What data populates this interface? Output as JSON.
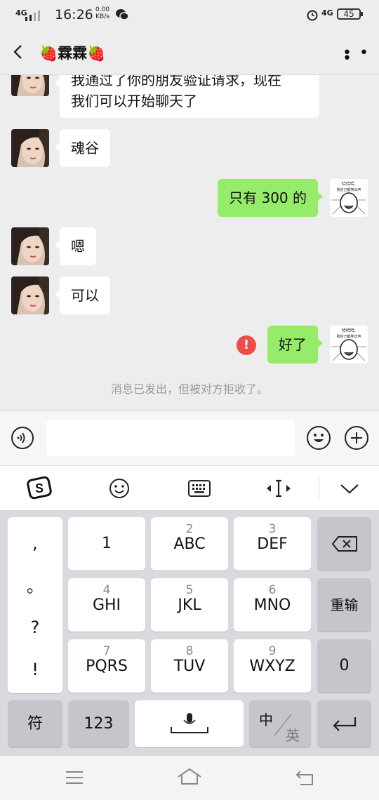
{
  "status_bar": {
    "network": "4G",
    "time": "16:26",
    "speed_value": "0.00",
    "speed_unit": "KB/s",
    "network2": "4G",
    "battery": "45"
  },
  "header": {
    "contact_name": "🍓霖霖🍓"
  },
  "messages": [
    {
      "side": "left",
      "text_line1": "我通过了你的朋友验证请求，现在",
      "text_line2": "我们可以开始聊天了"
    },
    {
      "side": "left",
      "text": "魂谷"
    },
    {
      "side": "right",
      "text": "只有 300 的"
    },
    {
      "side": "left",
      "text": "嗯"
    },
    {
      "side": "left",
      "text": "可以"
    },
    {
      "side": "right",
      "text": "好了",
      "error": "!"
    }
  ],
  "sticker_text": {
    "line1": "哈哈哈,",
    "line2": "我自己都笑出声"
  },
  "system_note": "消息已发出，但被对方拒收了。",
  "input": {
    "placeholder": ""
  },
  "keyboard": {
    "punctuation": [
      ",",
      "。",
      "?",
      "!"
    ],
    "keys": [
      {
        "num": "",
        "letters": "1"
      },
      {
        "num": "2",
        "letters": "ABC"
      },
      {
        "num": "3",
        "letters": "DEF"
      },
      {
        "num": "4",
        "letters": "GHI"
      },
      {
        "num": "5",
        "letters": "JKL"
      },
      {
        "num": "6",
        "letters": "MNO"
      },
      {
        "num": "7",
        "letters": "PQRS"
      },
      {
        "num": "8",
        "letters": "TUV"
      },
      {
        "num": "9",
        "letters": "WXYZ"
      }
    ],
    "retype": "重输",
    "zero": "0",
    "symbols": "符",
    "numbers": "123",
    "lang_zh": "中",
    "lang_en": "英"
  },
  "icons": [
    "signal-icon",
    "wechat-icon",
    "alarm-icon",
    "back-icon",
    "more-icon",
    "voice-icon",
    "emoji-icon",
    "plus-icon",
    "sogou-logo-icon",
    "smile-icon",
    "keyboard-icon",
    "cursor-icon",
    "collapse-icon",
    "backspace-icon",
    "mic-icon",
    "enter-icon",
    "menu-icon",
    "home-icon",
    "return-icon"
  ]
}
